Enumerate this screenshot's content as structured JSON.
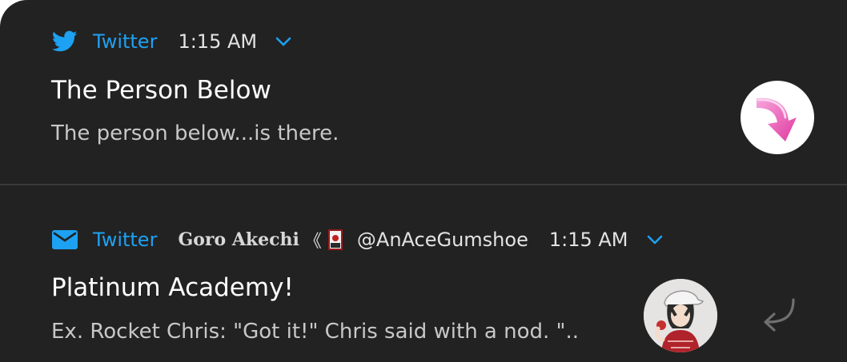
{
  "colors": {
    "panel_background": "#222222",
    "accent": "#1da1f2",
    "title_text": "#ffffff",
    "body_text": "#c8c8c8"
  },
  "notifications": [
    {
      "app_icon": "twitter-bird-icon",
      "app_name": "Twitter",
      "time": "1:15 AM",
      "expand_icon": "chevron-down-icon",
      "title": "The Person Below",
      "body": "The person below...is there.",
      "avatar": "pink-down-arrow-avatar"
    },
    {
      "app_icon": "envelope-icon",
      "app_name": "Twitter",
      "sender": "Goro Akechi",
      "sender_badge": "card-badge-icon",
      "handle": "@AnAceGumshoe",
      "time": "1:15 AM",
      "expand_icon": "chevron-down-icon",
      "title": "Platinum Academy!",
      "body": "Ex. Rocket Chris: \"Got it!\" Chris said with a nod.  \"..",
      "avatar": "user-avatar",
      "action_icon": "reply-arrow-icon"
    }
  ]
}
